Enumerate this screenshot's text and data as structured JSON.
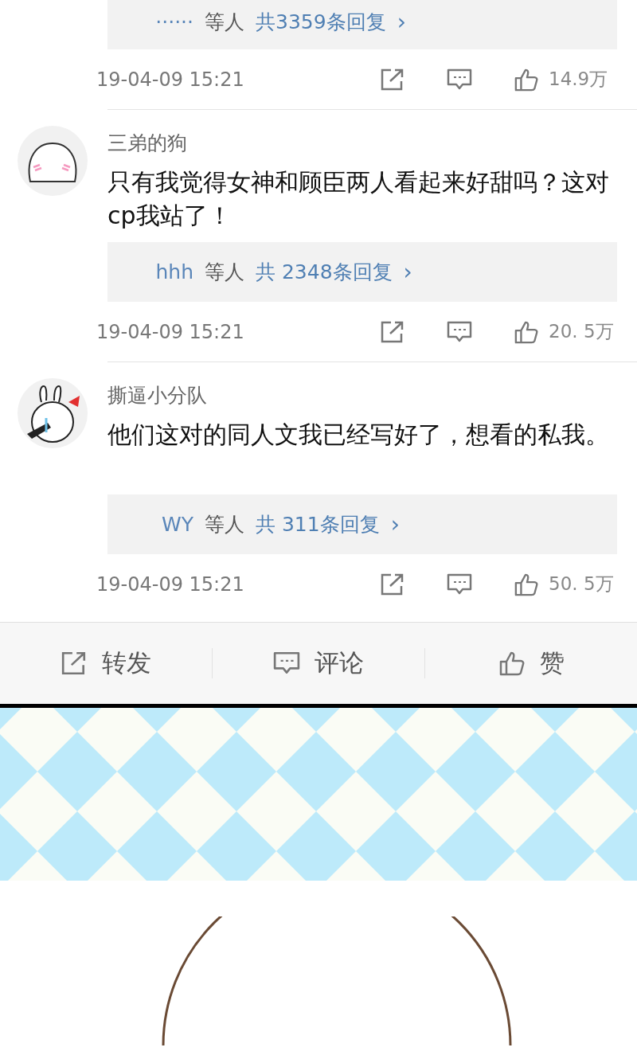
{
  "comments": [
    {
      "replies": {
        "names": "······",
        "suffix": "等人",
        "count": "共3359条回复",
        "chevron": "›"
      },
      "time": "19-04-09 15:21",
      "likes": "14.9万"
    },
    {
      "avatar": {
        "kind": "blob"
      },
      "user": "三弟的狗",
      "text": "只有我觉得女神和顾臣两人看起来好甜吗？这对cp我站了！",
      "replies": {
        "names": "hhh",
        "suffix": "等人",
        "count": "共 2348条回复",
        "chevron": "›"
      },
      "time": "19-04-09 15:21",
      "likes": "20. 5万"
    },
    {
      "avatar": {
        "kind": "rabbit"
      },
      "user": "撕逼小分队",
      "text": "他们这对的同人文我已经写好了，想看的私我。",
      "replies": {
        "names": "WY",
        "suffix": "等人",
        "count": "共  311条回复",
        "chevron": "›"
      },
      "time": "19-04-09 15:21",
      "likes": "50. 5万"
    }
  ],
  "action_bar": [
    {
      "kind": "share",
      "label": "转发"
    },
    {
      "kind": "comment",
      "label": "评论"
    },
    {
      "kind": "like",
      "label": "赞"
    }
  ]
}
